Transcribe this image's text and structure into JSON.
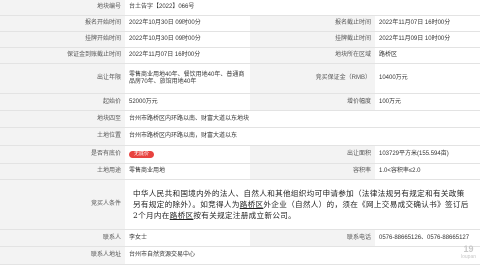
{
  "rows": {
    "plot_no": {
      "label": "地块编号",
      "value": "台土告字【2022】066号"
    },
    "announce": {
      "label1": "报名开始时间",
      "value1": "2022年10月30日 09时00分",
      "label2": "报名截止时间",
      "value2": "2022年11月07日 16时00分"
    },
    "listing": {
      "label1": "挂牌开始时间",
      "value1": "2022年10月30日 09时00分",
      "label2": "挂牌截止时间",
      "value2": "2022年11月09日 10时00分"
    },
    "deposit": {
      "label1": "保证金到账截止时间",
      "value1": "2022年11月07日 16时00分",
      "label2": "地块所在区域",
      "value2": "路桥区"
    },
    "use": {
      "label1": "出让年限",
      "value1": "零售商业用地40年、餐饮用地40年、普通商品房70年、旅馆用地40年",
      "label2": "竞买保证金（RMB）",
      "value2": "10400万元"
    },
    "price": {
      "label1": "起始价",
      "value1": "52000万元",
      "label2": "增价幅度",
      "value2": "100万元"
    },
    "range": {
      "label": "地块四至",
      "value": "台州市路桥区内环路以南、财富大道以东地块"
    },
    "location": {
      "label": "土地位置",
      "value": "台州市路桥区内环路以南，财富大道以东"
    },
    "floor": {
      "label1": "是否有底价",
      "badge": "无底价",
      "label2": "出让面积",
      "value2": "103729平方米(155.594亩)"
    },
    "landuse": {
      "label1": "土地用途",
      "value1": "零售商业用地",
      "label2": "容积率",
      "value2": "1.0<容积率≤2.0"
    },
    "conditions": {
      "label": "竞买人条件",
      "text_a": "中华人民共和国境内外的法人、自然人和其他组织均可申请参加（法律法规另有规定和有关政策另有规定的除外）。如竞得人为",
      "text_b": "路桥区",
      "text_c": "外企业（自然人）的，须在《网上交易成交确认书》签订后2个月内在",
      "text_d": "路桥区",
      "text_e": "按有关规定注册成立新公司。"
    },
    "contact": {
      "label1": "联系人",
      "value1": "李女士",
      "label2": "联系电话",
      "value2": "0576-88665126、0576-88665127"
    },
    "address": {
      "label": "联系人地址",
      "value": "台州市自然资源交易中心"
    }
  },
  "watermark": {
    "line1": "19",
    "line2": "loupan"
  }
}
